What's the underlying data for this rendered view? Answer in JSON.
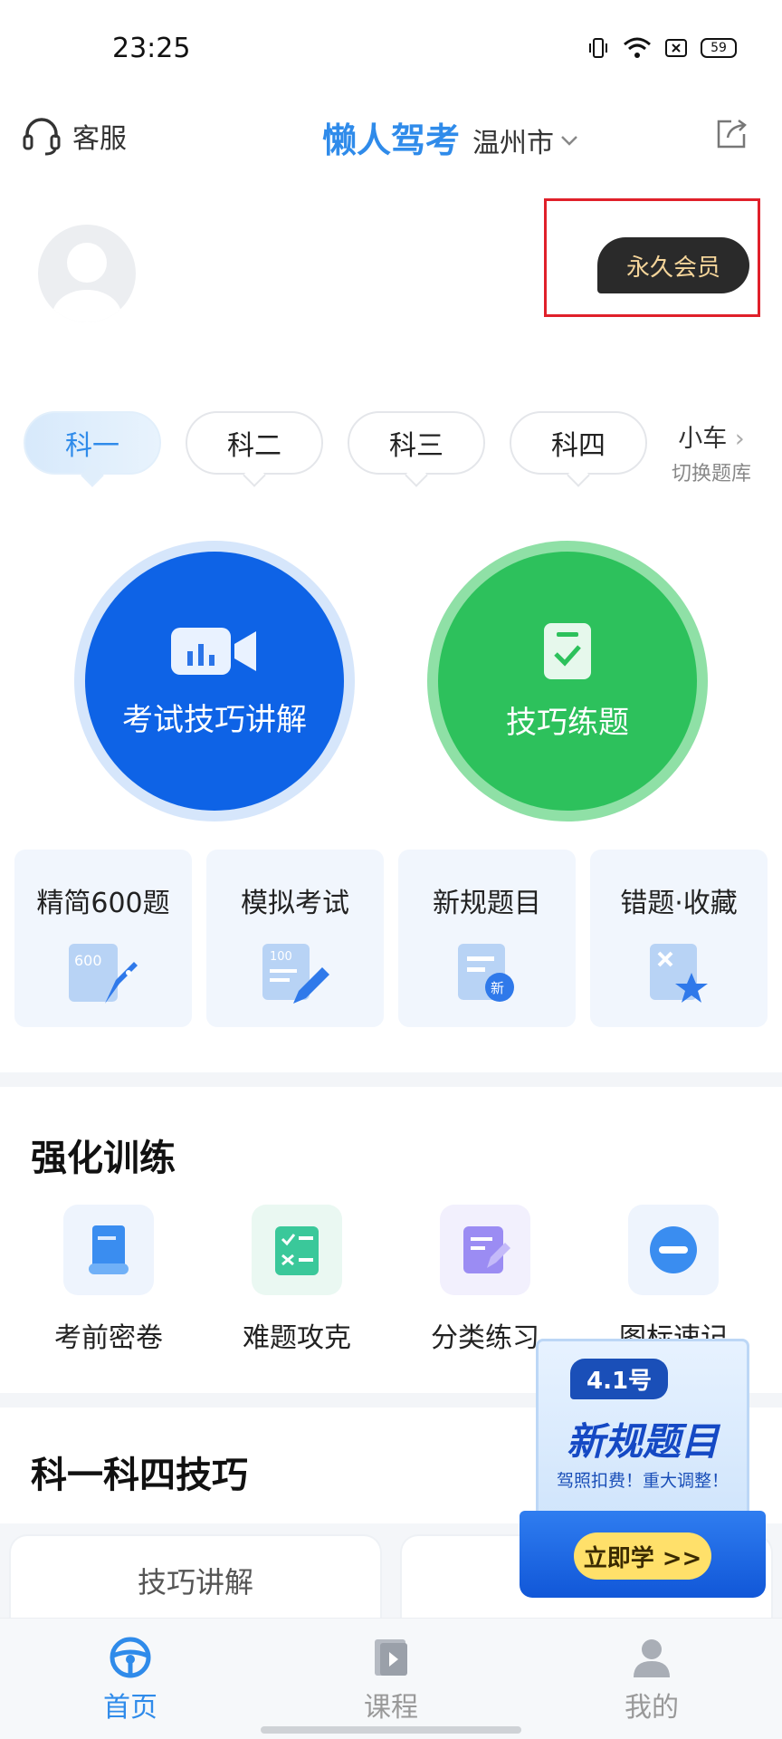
{
  "status_bar": {
    "time": "23:25",
    "battery": "59"
  },
  "header": {
    "service_label": "客服",
    "app_title": "懒人驾考",
    "city": "温州市"
  },
  "profile": {
    "vip_label": "永久会员"
  },
  "subject_tabs": [
    {
      "label": "科一",
      "active": true
    },
    {
      "label": "科二",
      "active": false
    },
    {
      "label": "科三",
      "active": false
    },
    {
      "label": "科四",
      "active": false
    }
  ],
  "vehicle_switch": {
    "vehicle": "小车",
    "hint": "切换题库"
  },
  "main_actions": {
    "video_label": "考试技巧讲解",
    "practice_label": "技巧练题"
  },
  "feature_cards": [
    {
      "label": "精简600题",
      "icon": "rocket-600-icon"
    },
    {
      "label": "模拟考试",
      "icon": "exam-paper-pencil-icon"
    },
    {
      "label": "新规题目",
      "icon": "new-rule-doc-icon"
    },
    {
      "label": "错题·收藏",
      "icon": "wrong-star-doc-icon"
    }
  ],
  "intensive": {
    "title": "强化训练",
    "items": [
      {
        "label": "考前密卷",
        "icon": "scroll-icon"
      },
      {
        "label": "难题攻克",
        "icon": "checklist-icon"
      },
      {
        "label": "分类练习",
        "icon": "edit-doc-icon"
      },
      {
        "label": "图标速记",
        "icon": "no-entry-icon"
      }
    ]
  },
  "skills": {
    "title": "科一科四技巧",
    "card1": "技巧讲解"
  },
  "promo": {
    "date": "4.1号",
    "title": "新规题目",
    "subtitle": "驾照扣费！重大调整！",
    "button": "立即学 >>"
  },
  "bottom_nav": [
    {
      "label": "首页",
      "active": true
    },
    {
      "label": "课程",
      "active": false
    },
    {
      "label": "我的",
      "active": false
    }
  ],
  "colors": {
    "brand_blue": "#2F8BEA",
    "deep_blue": "#0E63E6",
    "green": "#2DC15C",
    "vip_gold": "#F5D59A",
    "highlight_red": "#E0202A"
  }
}
